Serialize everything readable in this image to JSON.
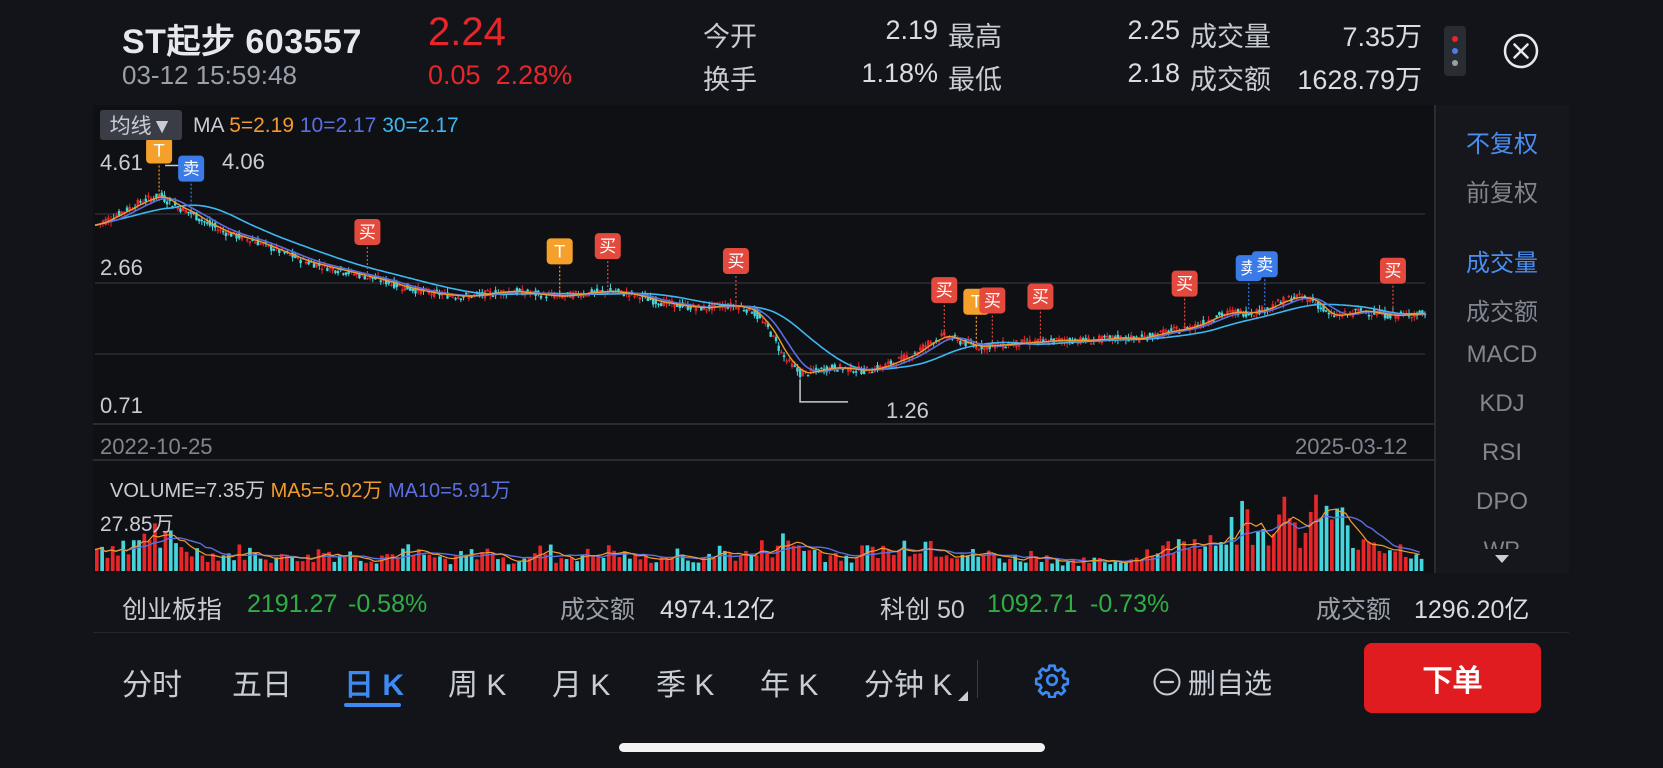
{
  "stock": {
    "name_code": "ST起步 603557",
    "datetime": "03-12 15:59:48",
    "price": "2.24",
    "change": "0.05",
    "change_pct": "2.28%"
  },
  "quote": {
    "open_label": "今开",
    "open_value": "2.19",
    "high_label": "最高",
    "high_value": "2.25",
    "volume_label": "成交量",
    "volume_value": "7.35万",
    "turnover_label": "换手",
    "turnover_value": "1.18%",
    "low_label": "最低",
    "low_value": "2.18",
    "amount_label": "成交额",
    "amount_value": "1628.79万"
  },
  "colors": {
    "up": "#e8262a",
    "down": "#44d6dc",
    "ma5": "#f29a2e",
    "ma10": "#5b6fe0",
    "ma30": "#3eb8f0",
    "buy": "#e4493e",
    "sell": "#3b7be8",
    "t": "#f5a02a",
    "accent": "#3d8af2",
    "order_button": "#e01c20"
  },
  "chart_legend": {
    "ma_select": "均线▼",
    "ma_prefix": "MA",
    "ma5": "5=2.19",
    "ma10": "10=2.17",
    "ma30": "30=2.17",
    "volume": "VOLUME=7.35万",
    "vol_ma5": "MA5=5.02万",
    "vol_ma10": "MA10=5.91万"
  },
  "chart_data": {
    "type": "line",
    "y_ticks": [
      "4.61",
      "2.66",
      "0.71"
    ],
    "ylim": [
      0.71,
      4.61
    ],
    "date_start": "2022-10-25",
    "date_end": "2025-03-12",
    "max_annotation": "4.06",
    "min_annotation": "1.26",
    "vol_max_label": "27.85万",
    "close_series": [
      3.6,
      3.72,
      3.85,
      3.98,
      4.06,
      3.9,
      3.78,
      3.62,
      3.5,
      3.42,
      3.35,
      3.25,
      3.15,
      3.05,
      2.98,
      2.92,
      2.86,
      2.8,
      2.74,
      2.66,
      2.6,
      2.55,
      2.52,
      2.5,
      2.52,
      2.56,
      2.58,
      2.55,
      2.52,
      2.5,
      2.53,
      2.56,
      2.58,
      2.55,
      2.5,
      2.42,
      2.38,
      2.34,
      2.32,
      2.36,
      2.35,
      2.28,
      2.0,
      1.55,
      1.3,
      1.35,
      1.4,
      1.38,
      1.35,
      1.4,
      1.5,
      1.6,
      1.78,
      1.9,
      1.8,
      1.72,
      1.74,
      1.76,
      1.78,
      1.8,
      1.82,
      1.82,
      1.82,
      1.84,
      1.86,
      1.84,
      1.9,
      1.96,
      2.0,
      2.08,
      2.2,
      2.26,
      2.24,
      2.3,
      2.42,
      2.5,
      2.44,
      2.2,
      2.22,
      2.28,
      2.24,
      2.2,
      2.22,
      2.24
    ],
    "markers": [
      {
        "type": "T",
        "label": "T",
        "index": 4
      },
      {
        "type": "sell",
        "label": "卖",
        "index": 6
      },
      {
        "type": "buy",
        "label": "买",
        "index": 17
      },
      {
        "type": "T",
        "label": "T",
        "index": 29
      },
      {
        "type": "buy",
        "label": "买",
        "index": 32
      },
      {
        "type": "buy",
        "label": "买",
        "index": 40
      },
      {
        "type": "buy",
        "label": "买",
        "index": 53
      },
      {
        "type": "T",
        "label": "T",
        "index": 55
      },
      {
        "type": "buy",
        "label": "买",
        "index": 56
      },
      {
        "type": "buy",
        "label": "买",
        "index": 59
      },
      {
        "type": "buy",
        "label": "买",
        "index": 68
      },
      {
        "type": "sell",
        "label": "卖",
        "index": 72
      },
      {
        "type": "sell",
        "label": "卖",
        "index": 73
      },
      {
        "type": "buy",
        "label": "买",
        "index": 81
      }
    ],
    "volume_series": [
      6,
      8,
      10,
      12,
      9,
      7,
      6,
      5,
      5,
      6,
      5,
      4,
      5,
      4,
      6,
      5,
      5,
      4,
      5,
      6,
      5,
      4,
      4,
      5,
      6,
      5,
      4,
      5,
      6,
      4,
      5,
      5,
      6,
      5,
      4,
      4,
      5,
      4,
      5,
      6,
      5,
      5,
      7,
      9,
      8,
      6,
      5,
      5,
      6,
      7,
      6,
      8,
      9,
      7,
      6,
      5,
      5,
      4,
      4,
      5,
      4,
      3,
      3,
      3,
      3,
      4,
      6,
      7,
      8,
      12,
      10,
      14,
      16,
      12,
      15,
      18,
      14,
      19,
      15,
      12,
      10,
      8,
      7,
      6
    ]
  },
  "right_tabs": [
    {
      "label": "不复权",
      "active": true
    },
    {
      "label": "前复权",
      "active": false
    },
    {
      "label": "成交量",
      "active": true
    },
    {
      "label": "成交额",
      "active": false
    },
    {
      "label": "MACD",
      "active": false
    },
    {
      "label": "KDJ",
      "active": false
    },
    {
      "label": "RSI",
      "active": false
    },
    {
      "label": "DPO",
      "active": false
    },
    {
      "label": "WR",
      "active": false
    }
  ],
  "indices": {
    "cyb_name": "创业板指",
    "cyb_value": "2191.27",
    "cyb_pct": "-0.58%",
    "cyb_amount_label": "成交额",
    "cyb_amount": "4974.12亿",
    "kc_name": "科创 50",
    "kc_value": "1092.71",
    "kc_pct": "-0.73%",
    "kc_amount_label": "成交额",
    "kc_amount": "1296.20亿"
  },
  "periods": [
    "分时",
    "五日",
    "日 K",
    "周 K",
    "月 K",
    "季 K",
    "年 K",
    "分钟 K"
  ],
  "active_period": "日 K",
  "actions": {
    "remove_watchlist": "删自选",
    "order": "下单"
  },
  "icons": [
    "more-dots-icon",
    "close-circle-icon",
    "gear-icon",
    "minus-circle-icon",
    "chevron-down-icon"
  ]
}
